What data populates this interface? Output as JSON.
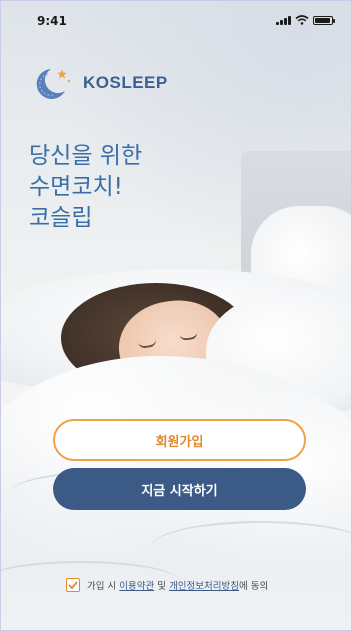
{
  "status_bar": {
    "time": "9:41",
    "signal": "signal-icon",
    "wifi": "wifi-icon",
    "battery": "battery-icon"
  },
  "logo": {
    "name": "KOSLEEP",
    "icon": "moon-star-logo-icon"
  },
  "headline": {
    "line1": "당신을 위한",
    "line2": "수면코치!",
    "line3": "코슬립"
  },
  "buttons": {
    "signup": "회원가입",
    "start": "지금 시작하기"
  },
  "consent": {
    "checked": true,
    "prefix": "가입 시",
    "terms_link": "이용약관",
    "conjunction": "및",
    "privacy_link": "개인정보처리방침",
    "suffix": "에 동의"
  },
  "colors": {
    "accent_orange": "#f0a24a",
    "primary_navy": "#3b5a86",
    "headline_blue": "#3a6fa6"
  }
}
